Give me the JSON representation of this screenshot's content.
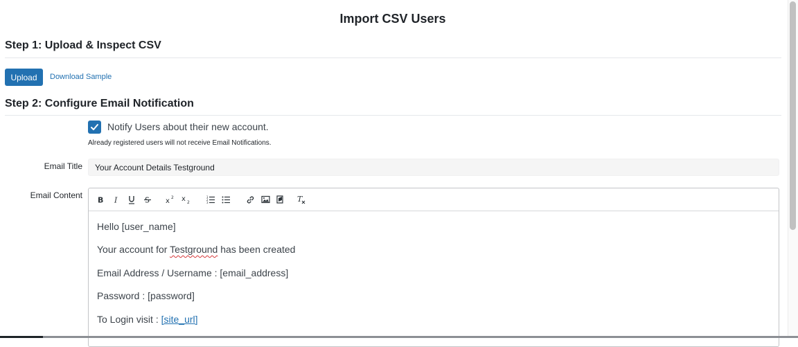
{
  "page": {
    "title": "Import CSV Users"
  },
  "step1": {
    "heading": "Step 1: Upload & Inspect CSV",
    "upload_label": "Upload",
    "download_label": "Download Sample"
  },
  "step2": {
    "heading": "Step 2: Configure Email Notification",
    "notify_checked": true,
    "notify_label": "Notify Users about their new account.",
    "note": "Already registered users will not receive Email Notifications.",
    "email_title_label": "Email Title",
    "email_title_value": "Your Account Details Testground",
    "email_content_label": "Email Content"
  },
  "editor": {
    "toolbar": [
      {
        "name": "bold-icon",
        "glyph": "B"
      },
      {
        "name": "italic-icon",
        "glyph": "I"
      },
      {
        "name": "underline-icon",
        "glyph": "U"
      },
      {
        "name": "strikethrough-icon",
        "glyph": "S"
      },
      {
        "name": "superscript-icon",
        "glyph": "x²"
      },
      {
        "name": "subscript-icon",
        "glyph": "x₂"
      },
      {
        "name": "ordered-list-icon",
        "glyph": "ol"
      },
      {
        "name": "bullet-list-icon",
        "glyph": "ul"
      },
      {
        "name": "link-icon",
        "glyph": "link"
      },
      {
        "name": "image-icon",
        "glyph": "img"
      },
      {
        "name": "video-icon",
        "glyph": "vid"
      },
      {
        "name": "clear-format-icon",
        "glyph": "Tx"
      }
    ],
    "lines": {
      "greeting": "Hello [user_name]",
      "account_prefix": "Your account for ",
      "account_site": "Testground",
      "account_suffix": " has been created",
      "email_line": "Email Address / Username : [email_address]",
      "password_line": "Password : [password]",
      "login_prefix": "To Login visit : ",
      "login_link": "[site_url]"
    }
  },
  "colors": {
    "primary": "#2271b1",
    "spellcheck": "#d63638"
  }
}
